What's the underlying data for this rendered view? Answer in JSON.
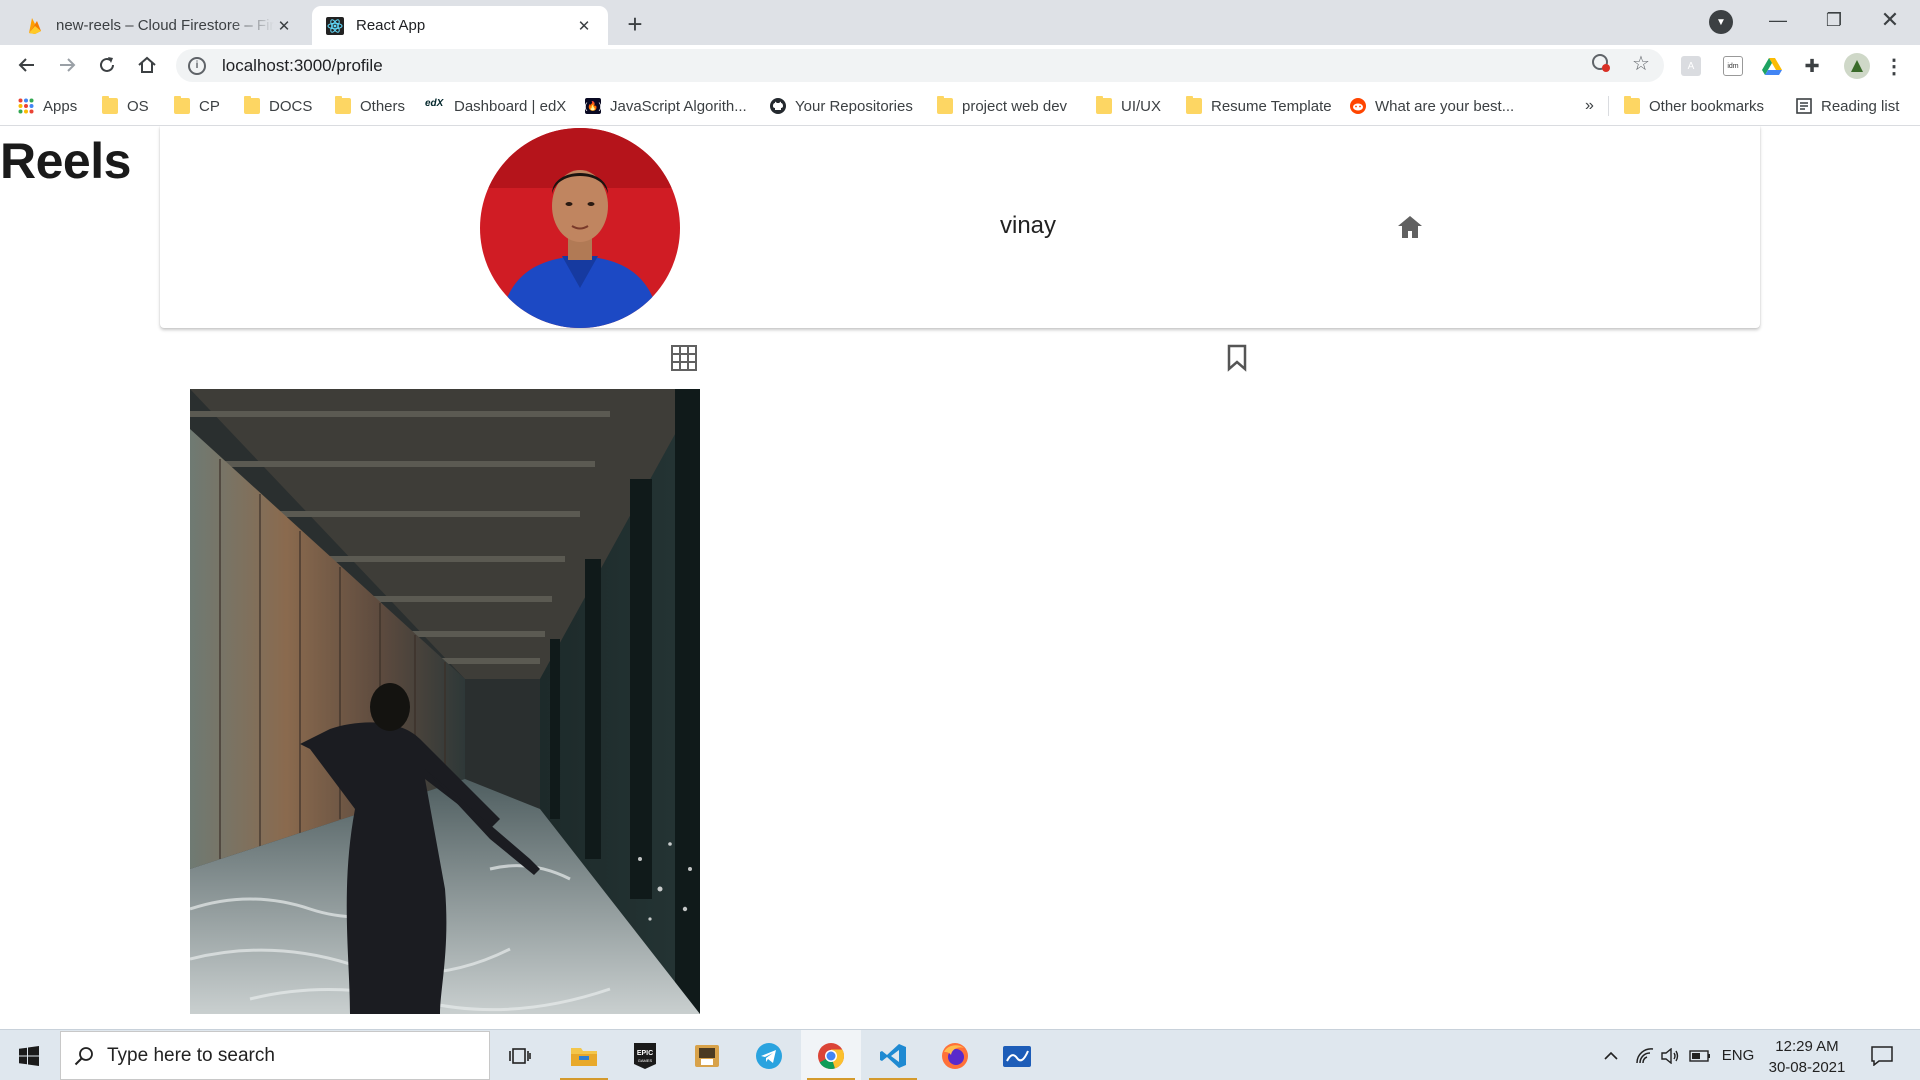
{
  "browser": {
    "tabs": [
      {
        "title": "new-reels – Cloud Firestore – Firebase console",
        "icon": "firebase-icon",
        "active": false
      },
      {
        "title": "React App",
        "icon": "react-icon",
        "active": true
      }
    ],
    "url": "localhost:3000/profile",
    "bookmarks": [
      {
        "label": "Apps",
        "icon": "apps-grid-icon"
      },
      {
        "label": "OS",
        "icon": "folder-icon"
      },
      {
        "label": "CP",
        "icon": "folder-icon"
      },
      {
        "label": "DOCS",
        "icon": "folder-icon"
      },
      {
        "label": "Others",
        "icon": "folder-icon"
      },
      {
        "label": "Dashboard | edX",
        "icon": "edx-icon"
      },
      {
        "label": "JavaScript Algorith...",
        "icon": "freecodecamp-icon"
      },
      {
        "label": "Your Repositories",
        "icon": "github-icon"
      },
      {
        "label": "project web dev",
        "icon": "folder-icon"
      },
      {
        "label": "UI/UX",
        "icon": "folder-icon"
      },
      {
        "label": "Resume Template",
        "icon": "folder-icon"
      },
      {
        "label": "What are your best...",
        "icon": "reddit-icon"
      }
    ],
    "more_bookmarks": "»",
    "other_bookmarks": "Other bookmarks",
    "reading_list": "Reading list"
  },
  "app": {
    "brand": "Reels",
    "profile": {
      "username": "vinay",
      "avatar_alt": "profile picture"
    },
    "tabs": [
      {
        "name": "posts-grid",
        "icon": "grid-icon"
      },
      {
        "name": "saved",
        "icon": "bookmark-icon"
      }
    ]
  },
  "taskbar": {
    "search_placeholder": "Type here to search",
    "language": "ENG",
    "time": "12:29 AM",
    "date": "30-08-2021"
  },
  "colors": {
    "accent_chrome": "#1a73e8",
    "folder": "#fdd663",
    "taskbar": "#dfe7ee"
  }
}
